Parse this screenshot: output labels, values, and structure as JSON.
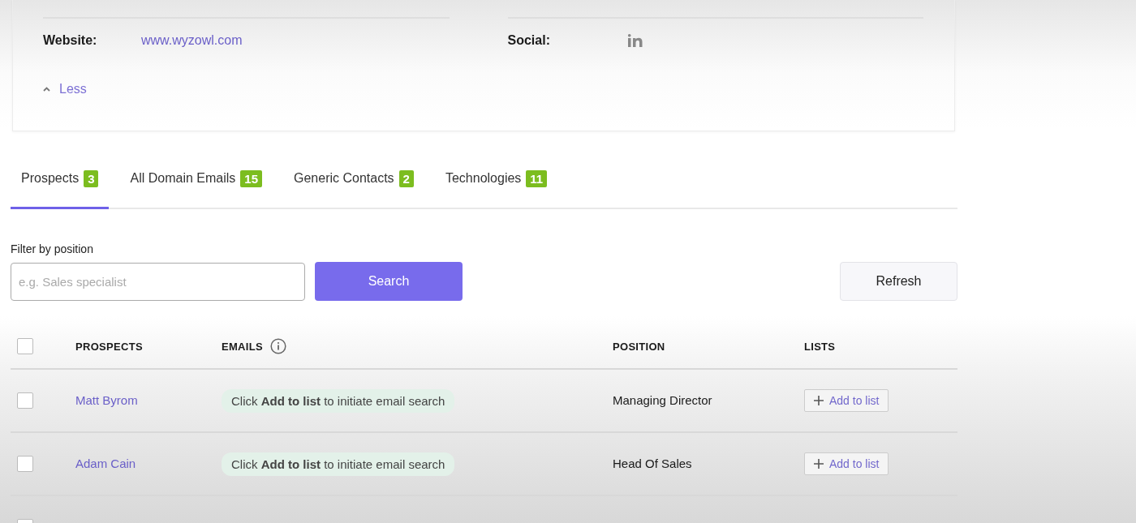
{
  "company_card": {
    "fields": [
      {
        "label": "Website:",
        "value": "www.wyzowl.com",
        "kind": "link"
      },
      {
        "label": "Social:",
        "kind": "social"
      }
    ],
    "toggle": {
      "label": "Less",
      "expanded": true
    }
  },
  "tabs": [
    {
      "label": "Prospects",
      "count": "3",
      "selected": true
    },
    {
      "label": "All Domain Emails",
      "count": "15",
      "selected": false
    },
    {
      "label": "Generic Contacts",
      "count": "2",
      "selected": false
    },
    {
      "label": "Technologies",
      "count": "11",
      "selected": false
    }
  ],
  "filter": {
    "label": "Filter by position",
    "placeholder": "e.g. Sales specialist",
    "search_button": "Search",
    "refresh_button": "Refresh"
  },
  "table": {
    "select_all_checked": false,
    "columns": [
      "PROSPECTS",
      "EMAILS",
      "POSITION",
      "LISTS"
    ],
    "rows": [
      {
        "checked": false,
        "name": "Matt Byrom",
        "email": "Click **Add to list** to initiate email search",
        "position": "Managing Director",
        "action": "Add to list"
      },
      {
        "checked": false,
        "name": "Adam Cain",
        "email": "Click **Add to list** to initiate email search",
        "position": "Head Of Sales",
        "action": "Add to list"
      },
      {
        "checked": false
      }
    ]
  }
}
